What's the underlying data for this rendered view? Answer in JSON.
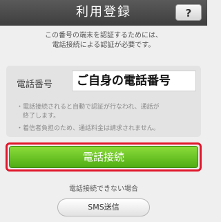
{
  "header": {
    "title": "利用登録",
    "help_label": "?"
  },
  "intro": {
    "line1": "この番号の端末を認証するためには、",
    "line2": "電話接続による認証が必要です。"
  },
  "phone": {
    "label": "電話番号",
    "value": "ご自身の電話番号"
  },
  "notes": [
    {
      "line1": "・電話接続されると自動で認証が行なわれ、通話が",
      "line2": "　終了します。"
    },
    {
      "line1": "・着信者負担のため、通話料金は請求されません。"
    }
  ],
  "connect_button": {
    "label": "電話接続"
  },
  "alt": {
    "cannot_label": "電話接続できない場合",
    "sms_button": "SMS送信"
  },
  "colors": {
    "accent_green": "#5cc11f",
    "highlight_red": "#e0162b"
  }
}
